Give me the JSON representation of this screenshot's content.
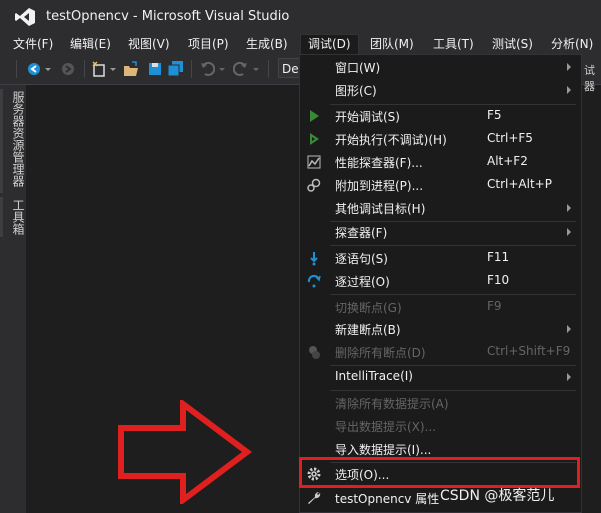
{
  "window": {
    "title": "testOpnencv - Microsoft Visual Studio"
  },
  "menubar": {
    "items": [
      "文件(F)",
      "编辑(E)",
      "视图(V)",
      "项目(P)",
      "生成(B)",
      "调试(D)",
      "团队(M)",
      "工具(T)",
      "测试(S)",
      "分析(N)"
    ],
    "active": "调试(D)"
  },
  "toolbar": {
    "config_combo": "De",
    "right_text": "试器"
  },
  "left_panel": {
    "tabs": [
      "服务器资源管理器",
      "工具箱"
    ]
  },
  "debug_menu": {
    "items": [
      {
        "label": "窗口(W)",
        "shortcut": "",
        "submenu": true,
        "enabled": true,
        "icon": "none"
      },
      {
        "label": "图形(C)",
        "shortcut": "",
        "submenu": true,
        "enabled": true,
        "icon": "none"
      },
      {
        "label": "开始调试(S)",
        "shortcut": "F5",
        "submenu": false,
        "enabled": true,
        "icon": "play-icon"
      },
      {
        "label": "开始执行(不调试)(H)",
        "shortcut": "Ctrl+F5",
        "submenu": false,
        "enabled": true,
        "icon": "play-outline-icon"
      },
      {
        "label": "性能探查器(F)...",
        "shortcut": "Alt+F2",
        "submenu": false,
        "enabled": true,
        "icon": "profiler-icon"
      },
      {
        "label": "附加到进程(P)...",
        "shortcut": "Ctrl+Alt+P",
        "submenu": false,
        "enabled": true,
        "icon": "attach-process-icon"
      },
      {
        "label": "其他调试目标(H)",
        "shortcut": "",
        "submenu": true,
        "enabled": true,
        "icon": "none"
      },
      {
        "label": "探查器(F)",
        "shortcut": "",
        "submenu": true,
        "enabled": true,
        "icon": "none"
      },
      {
        "label": "逐语句(S)",
        "shortcut": "F11",
        "submenu": false,
        "enabled": true,
        "icon": "step-into-icon"
      },
      {
        "label": "逐过程(O)",
        "shortcut": "F10",
        "submenu": false,
        "enabled": true,
        "icon": "step-over-icon"
      },
      {
        "label": "切换断点(G)",
        "shortcut": "F9",
        "submenu": false,
        "enabled": false,
        "icon": "none"
      },
      {
        "label": "新建断点(B)",
        "shortcut": "",
        "submenu": true,
        "enabled": true,
        "icon": "none"
      },
      {
        "label": "删除所有断点(D)",
        "shortcut": "Ctrl+Shift+F9",
        "submenu": false,
        "enabled": false,
        "icon": "delete-breakpoints-icon"
      },
      {
        "label": "IntelliTrace(I)",
        "shortcut": "",
        "submenu": true,
        "enabled": true,
        "icon": "none"
      },
      {
        "label": "清除所有数据提示(A)",
        "shortcut": "",
        "submenu": false,
        "enabled": false,
        "icon": "none"
      },
      {
        "label": "导出数据提示(X)...",
        "shortcut": "",
        "submenu": false,
        "enabled": false,
        "icon": "none"
      },
      {
        "label": "导入数据提示(I)...",
        "shortcut": "",
        "submenu": false,
        "enabled": true,
        "icon": "none"
      },
      {
        "label": "选项(O)...",
        "shortcut": "",
        "submenu": false,
        "enabled": true,
        "icon": "gear-icon"
      },
      {
        "label": "testOpnencv 属性",
        "shortcut": "",
        "submenu": false,
        "enabled": true,
        "icon": "wrench-icon"
      }
    ]
  },
  "annotation": {
    "highlight_color": "#e0201f",
    "arrow_color": "#e0201f"
  },
  "watermark": "CSDN @极客范儿",
  "colors": {
    "background": "#1e1e1e",
    "chrome": "#2d2d30",
    "menu_bg": "#1b1b1c",
    "play_green": "#388a34",
    "step_blue": "#1e90d6"
  }
}
